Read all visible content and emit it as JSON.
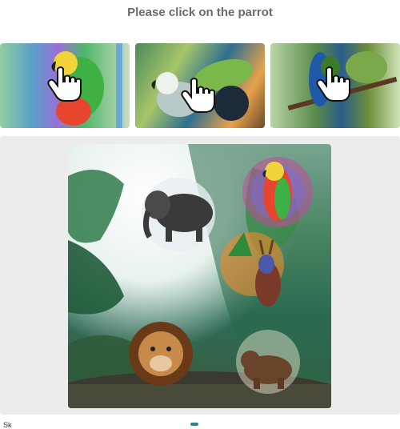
{
  "instruction": "Please click on the parrot",
  "examples": [
    {
      "label": "example-1"
    },
    {
      "label": "example-2"
    },
    {
      "label": "example-3"
    }
  ],
  "scene": {
    "animals": [
      "elephant",
      "parrot",
      "deer",
      "lion",
      "bear"
    ]
  },
  "footer": {
    "left_text": "Sk"
  }
}
